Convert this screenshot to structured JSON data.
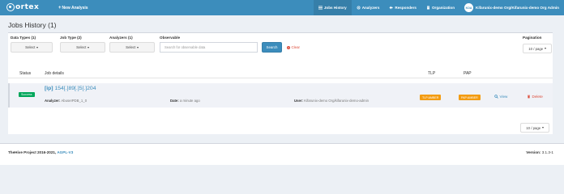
{
  "navbar": {
    "logo_text": "ortex",
    "new_analysis": "New Analysis",
    "items": [
      {
        "label": "Jobs History",
        "icon": "list-icon",
        "active": true
      },
      {
        "label": "Analyzers",
        "icon": "cogs-icon",
        "active": false
      },
      {
        "label": "Responders",
        "icon": "responder-icon",
        "active": false
      },
      {
        "label": "Organization",
        "icon": "building-icon",
        "active": false
      }
    ],
    "user_initials": "KOA",
    "user_label": "Kifarunix-demo Org/Kifarunix-demo Org Admin"
  },
  "page": {
    "title": "Jobs History (1)"
  },
  "filters": {
    "data_types": {
      "label": "Data Types (1)",
      "value": "Select"
    },
    "job_type": {
      "label": "Job Type (2)",
      "value": "Select"
    },
    "analyzers": {
      "label": "Analyzers (1)",
      "value": "Select"
    },
    "observable": {
      "label": "Observable",
      "placeholder": "Search for observable data"
    },
    "search_label": "Search",
    "clear_label": "Clear",
    "pagination": {
      "label": "Pagination",
      "value": "10 / page"
    }
  },
  "table": {
    "headers": {
      "status": "Status",
      "job_details": "Job details",
      "tlp": "TLP",
      "pap": "PAP"
    },
    "rows": [
      {
        "status": "Success",
        "type": "[ip]",
        "observable": "154[.]89[.]5[.]204",
        "analyzer_label": "Analyzer:",
        "analyzer": "AbuseIPDB_1_0",
        "date_label": "Date:",
        "date": "a minute ago",
        "user_label": "User:",
        "user": "Kifarunix-demo Org/kifarunix-demo-admin",
        "tlp": "TLP:AMBER",
        "pap": "PAP:AMBER",
        "view_label": "View",
        "delete_label": "Delete"
      }
    ]
  },
  "bottom_pagination": {
    "value": "10 / page"
  },
  "footer": {
    "project": "TheHive Project 2016-2021,",
    "license": "AGPL-V3",
    "version_label": "Version:",
    "version": "3.1.3-1"
  },
  "colors": {
    "navbar": "#3c8dbc",
    "success": "#00a65a",
    "amber": "#f39c12",
    "danger": "#dd4b39"
  }
}
